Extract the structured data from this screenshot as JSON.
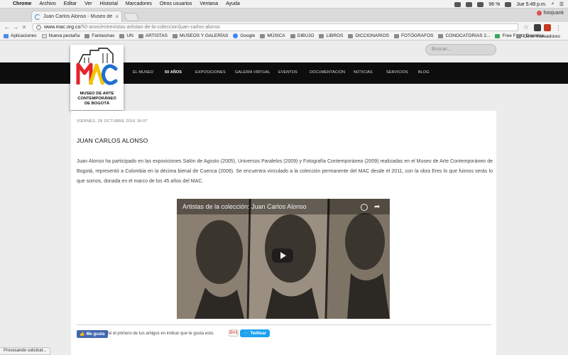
{
  "menubar": {
    "app": "Chrome",
    "items": [
      "Archivo",
      "Editar",
      "Ver",
      "Historial",
      "Marcadores",
      "Otros usuarios",
      "Ventana",
      "Ayuda"
    ],
    "battery": "96 %",
    "clock": "Jue 5:49 p.m."
  },
  "tab": {
    "title": "Juan Carlos Alonso - Museo de Ar",
    "profile": "fotojuank"
  },
  "address": {
    "host": "www.mac.org.co",
    "path": "/50-anos/entrevistas-artistas-de-la-coleccion/juan-carlos-alonso"
  },
  "bookmarks": {
    "items": [
      "Aplicaciones",
      "Nueva pestaña",
      "Fantasmas",
      "UN",
      "ARTISTAS",
      "MUSEOS Y GALERÍAS",
      "Google",
      "MÚSICA",
      "DIBUJO",
      "LIBROS",
      "DICCIONARIOS",
      "FOTÓGRAFOS",
      "CONOCATORIAS 2...",
      "Free Fonts Downloa..."
    ],
    "other": "Otros marcadores"
  },
  "site": {
    "logo_lines": [
      "MUSEO DE ARTE",
      "CONTEMPORÁNEO",
      "DE BOGOTÁ"
    ],
    "search_placeholder": "Buscar...",
    "nav": [
      "EL MUSEO",
      "50 AÑOS",
      "EXPOSICIONES",
      "GALERÍA VIRTUAL",
      "EVENTOS",
      "DOCUMENTACIÓN",
      "NOTICIAS",
      "SERVICIOS",
      "BLOG"
    ],
    "active_nav": "50 AÑOS"
  },
  "article": {
    "date": "VIERNES, 28 OCTUBRE 2016 18:07",
    "title": "JUAN CARLOS ALONSO",
    "body": "Juan Alonso ha participado en las exposiciones Salón de Agosto (2005), Universos Paralelos (2009) y Fotografía Contemporánea (2009) realizadas en el Museo de Arte Contemporáneo de Bogotá, representó a Colombia en la décima bienal de Cuenca (2009). Se encuentra vinculado a la colección permanente del MAC desde el 2011, con la obra Eres lo que fuimos serás lo que somos, donada en el marco de los 45 años del MAC.",
    "video_title": "Artistas de la colección: Juan Carlos Alonso"
  },
  "social": {
    "like_label": "Me gusta",
    "like_text": "Sé el primero de tus amigos en indicar que te gusta esto.",
    "gplus_label": "G+1",
    "tweet_label": "Twittear"
  },
  "status": "Procesando solicitud...",
  "colors": {
    "mac_red": "#e3242b",
    "mac_yellow": "#f5c400",
    "mac_blue": "#1f6fd1",
    "nav_bg": "#0d0d0d",
    "fb_blue": "#4267b2",
    "twitter_blue": "#1da1f2"
  }
}
